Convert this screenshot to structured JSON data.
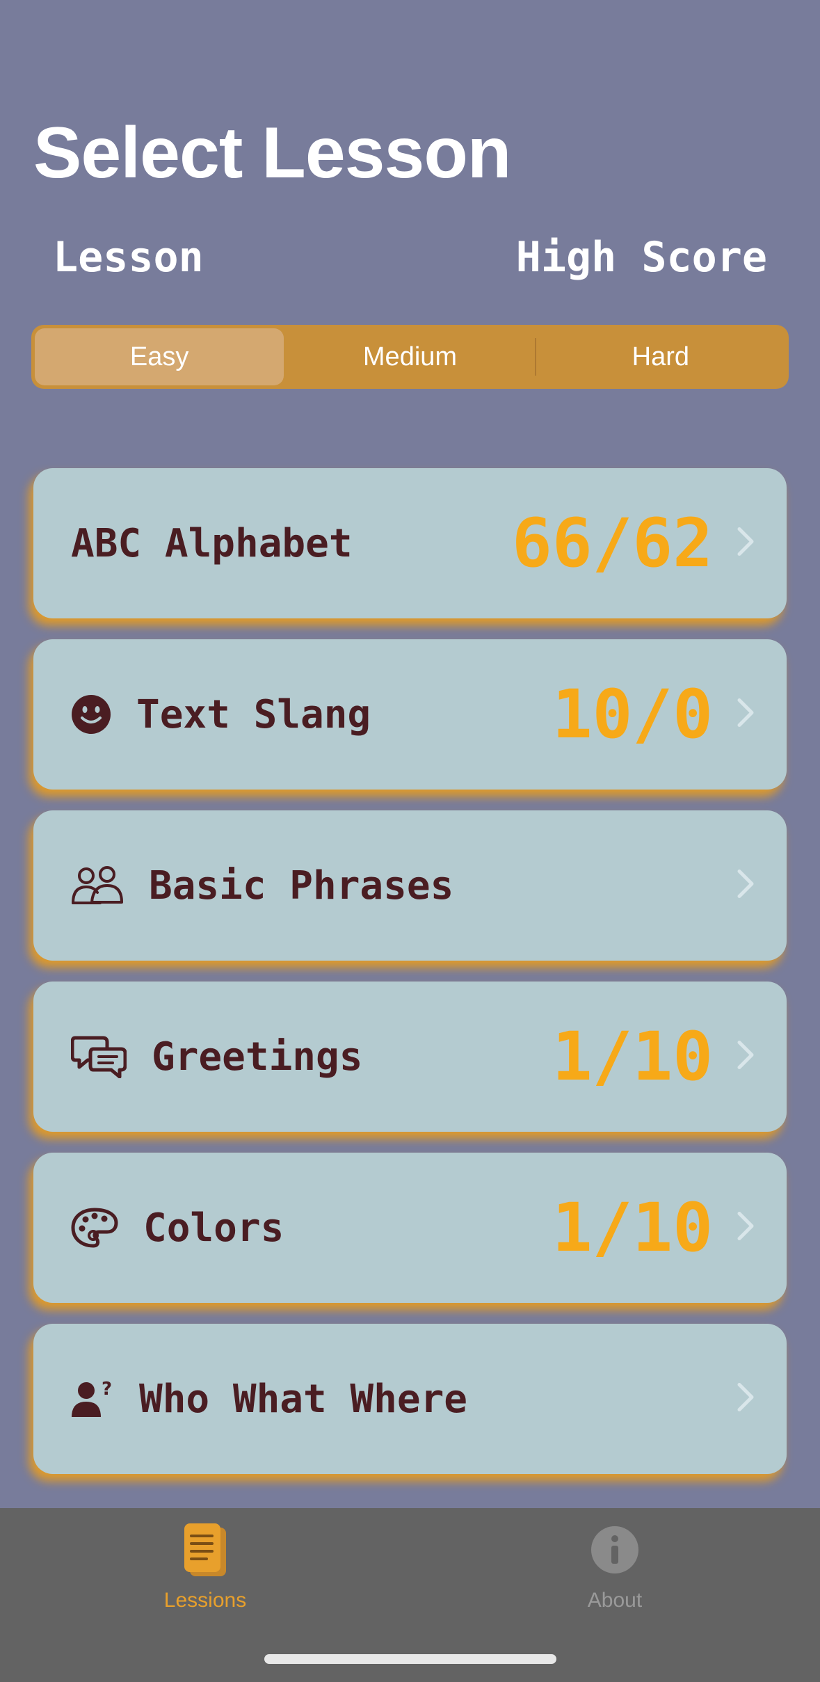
{
  "header": {
    "title": "Select Lesson",
    "col_lesson": "Lesson",
    "col_high_score": "High Score"
  },
  "difficulty": {
    "options": [
      "Easy",
      "Medium",
      "Hard"
    ],
    "selected": "Easy"
  },
  "lessons": [
    {
      "label": "ABC Alphabet",
      "score": "66/62",
      "icon": "none"
    },
    {
      "label": "Text Slang",
      "score": "10/0",
      "icon": "smiley-face-icon"
    },
    {
      "label": "Basic Phrases",
      "score": "",
      "icon": "two-people-icon"
    },
    {
      "label": "Greetings",
      "score": "1/10",
      "icon": "chat-bubbles-icon"
    },
    {
      "label": "Colors",
      "score": "1/10",
      "icon": "palette-icon"
    },
    {
      "label": "Who What Where",
      "score": "",
      "icon": "person-question-icon"
    }
  ],
  "tabbar": {
    "lessons_label": "Lessions",
    "about_label": "About",
    "active": "Lessions"
  },
  "colors": {
    "background": "#787c9b",
    "accent": "#f7a918",
    "card": "#b4cbd0",
    "text_dark": "#4a1d22",
    "segment": "#c8903a"
  }
}
